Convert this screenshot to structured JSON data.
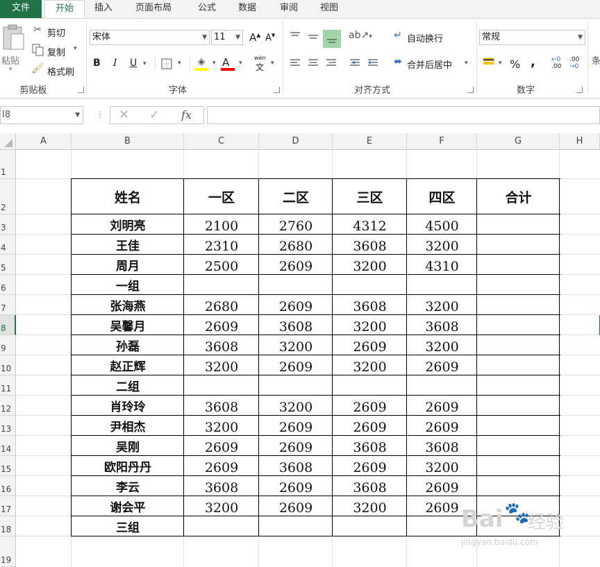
{
  "tabs": {
    "file": "文件",
    "items": [
      "开始",
      "插入",
      "页面布局",
      "公式",
      "数据",
      "审阅",
      "视图"
    ]
  },
  "ribbon": {
    "clipboard": {
      "paste": "粘贴",
      "cut": "剪切",
      "copy": "复制",
      "format_painter": "格式刷",
      "label": "剪贴板"
    },
    "font": {
      "name": "宋体",
      "size": "11",
      "bold": "B",
      "italic": "I",
      "underline": "U",
      "label": "字体",
      "grow": "A",
      "shrink": "A",
      "fill_color": "#ffff00",
      "font_color": "#ff0000",
      "wen": "wén"
    },
    "alignment": {
      "wrap_text": "自动换行",
      "merge_center": "合并后居中",
      "label": "对齐方式"
    },
    "number": {
      "format": "常规",
      "percent": "%",
      "comma": ",",
      "inc_decimal": ".00",
      "dec_decimal": ".0",
      "label": "数字"
    },
    "more": "条"
  },
  "formula_bar": {
    "name_box": "I8",
    "fx": "fx",
    "value": ""
  },
  "columns": [
    "A",
    "B",
    "C",
    "D",
    "E",
    "F",
    "G",
    "H"
  ],
  "rows": [
    "1",
    "2",
    "3",
    "4",
    "5",
    "6",
    "7",
    "8",
    "9",
    "10",
    "11",
    "12",
    "13",
    "14",
    "15",
    "16",
    "17",
    "18",
    "19"
  ],
  "selected_row": "8",
  "table": {
    "headers": [
      "姓名",
      "一区",
      "二区",
      "三区",
      "四区",
      "合计"
    ],
    "rows": [
      [
        "刘明亮",
        "2100",
        "2760",
        "4312",
        "4500",
        ""
      ],
      [
        "王佳",
        "2310",
        "2680",
        "3608",
        "3200",
        ""
      ],
      [
        "周月",
        "2500",
        "2609",
        "3200",
        "4310",
        ""
      ],
      [
        "一组",
        "",
        "",
        "",
        "",
        ""
      ],
      [
        "张海燕",
        "2680",
        "2609",
        "3608",
        "3200",
        ""
      ],
      [
        "吴馨月",
        "2609",
        "3608",
        "3200",
        "3608",
        ""
      ],
      [
        "孙磊",
        "3608",
        "3200",
        "2609",
        "3200",
        ""
      ],
      [
        "赵正辉",
        "3200",
        "2609",
        "3200",
        "2609",
        ""
      ],
      [
        "二组",
        "",
        "",
        "",
        "",
        ""
      ],
      [
        "肖玲玲",
        "3608",
        "3200",
        "2609",
        "2609",
        ""
      ],
      [
        "尹相杰",
        "3200",
        "2609",
        "2609",
        "2609",
        ""
      ],
      [
        "吴刚",
        "2609",
        "2609",
        "3608",
        "3608",
        ""
      ],
      [
        "欧阳丹丹",
        "2609",
        "3608",
        "2609",
        "3200",
        ""
      ],
      [
        "李云",
        "3608",
        "2609",
        "3608",
        "2609",
        ""
      ],
      [
        "谢会平",
        "3200",
        "2609",
        "3200",
        "2609",
        ""
      ],
      [
        "三组",
        "",
        "",
        "",
        "",
        ""
      ]
    ]
  },
  "watermark": {
    "brand": "Bai",
    "brand2": "经验",
    "url": "jingyan.baidu.com"
  }
}
